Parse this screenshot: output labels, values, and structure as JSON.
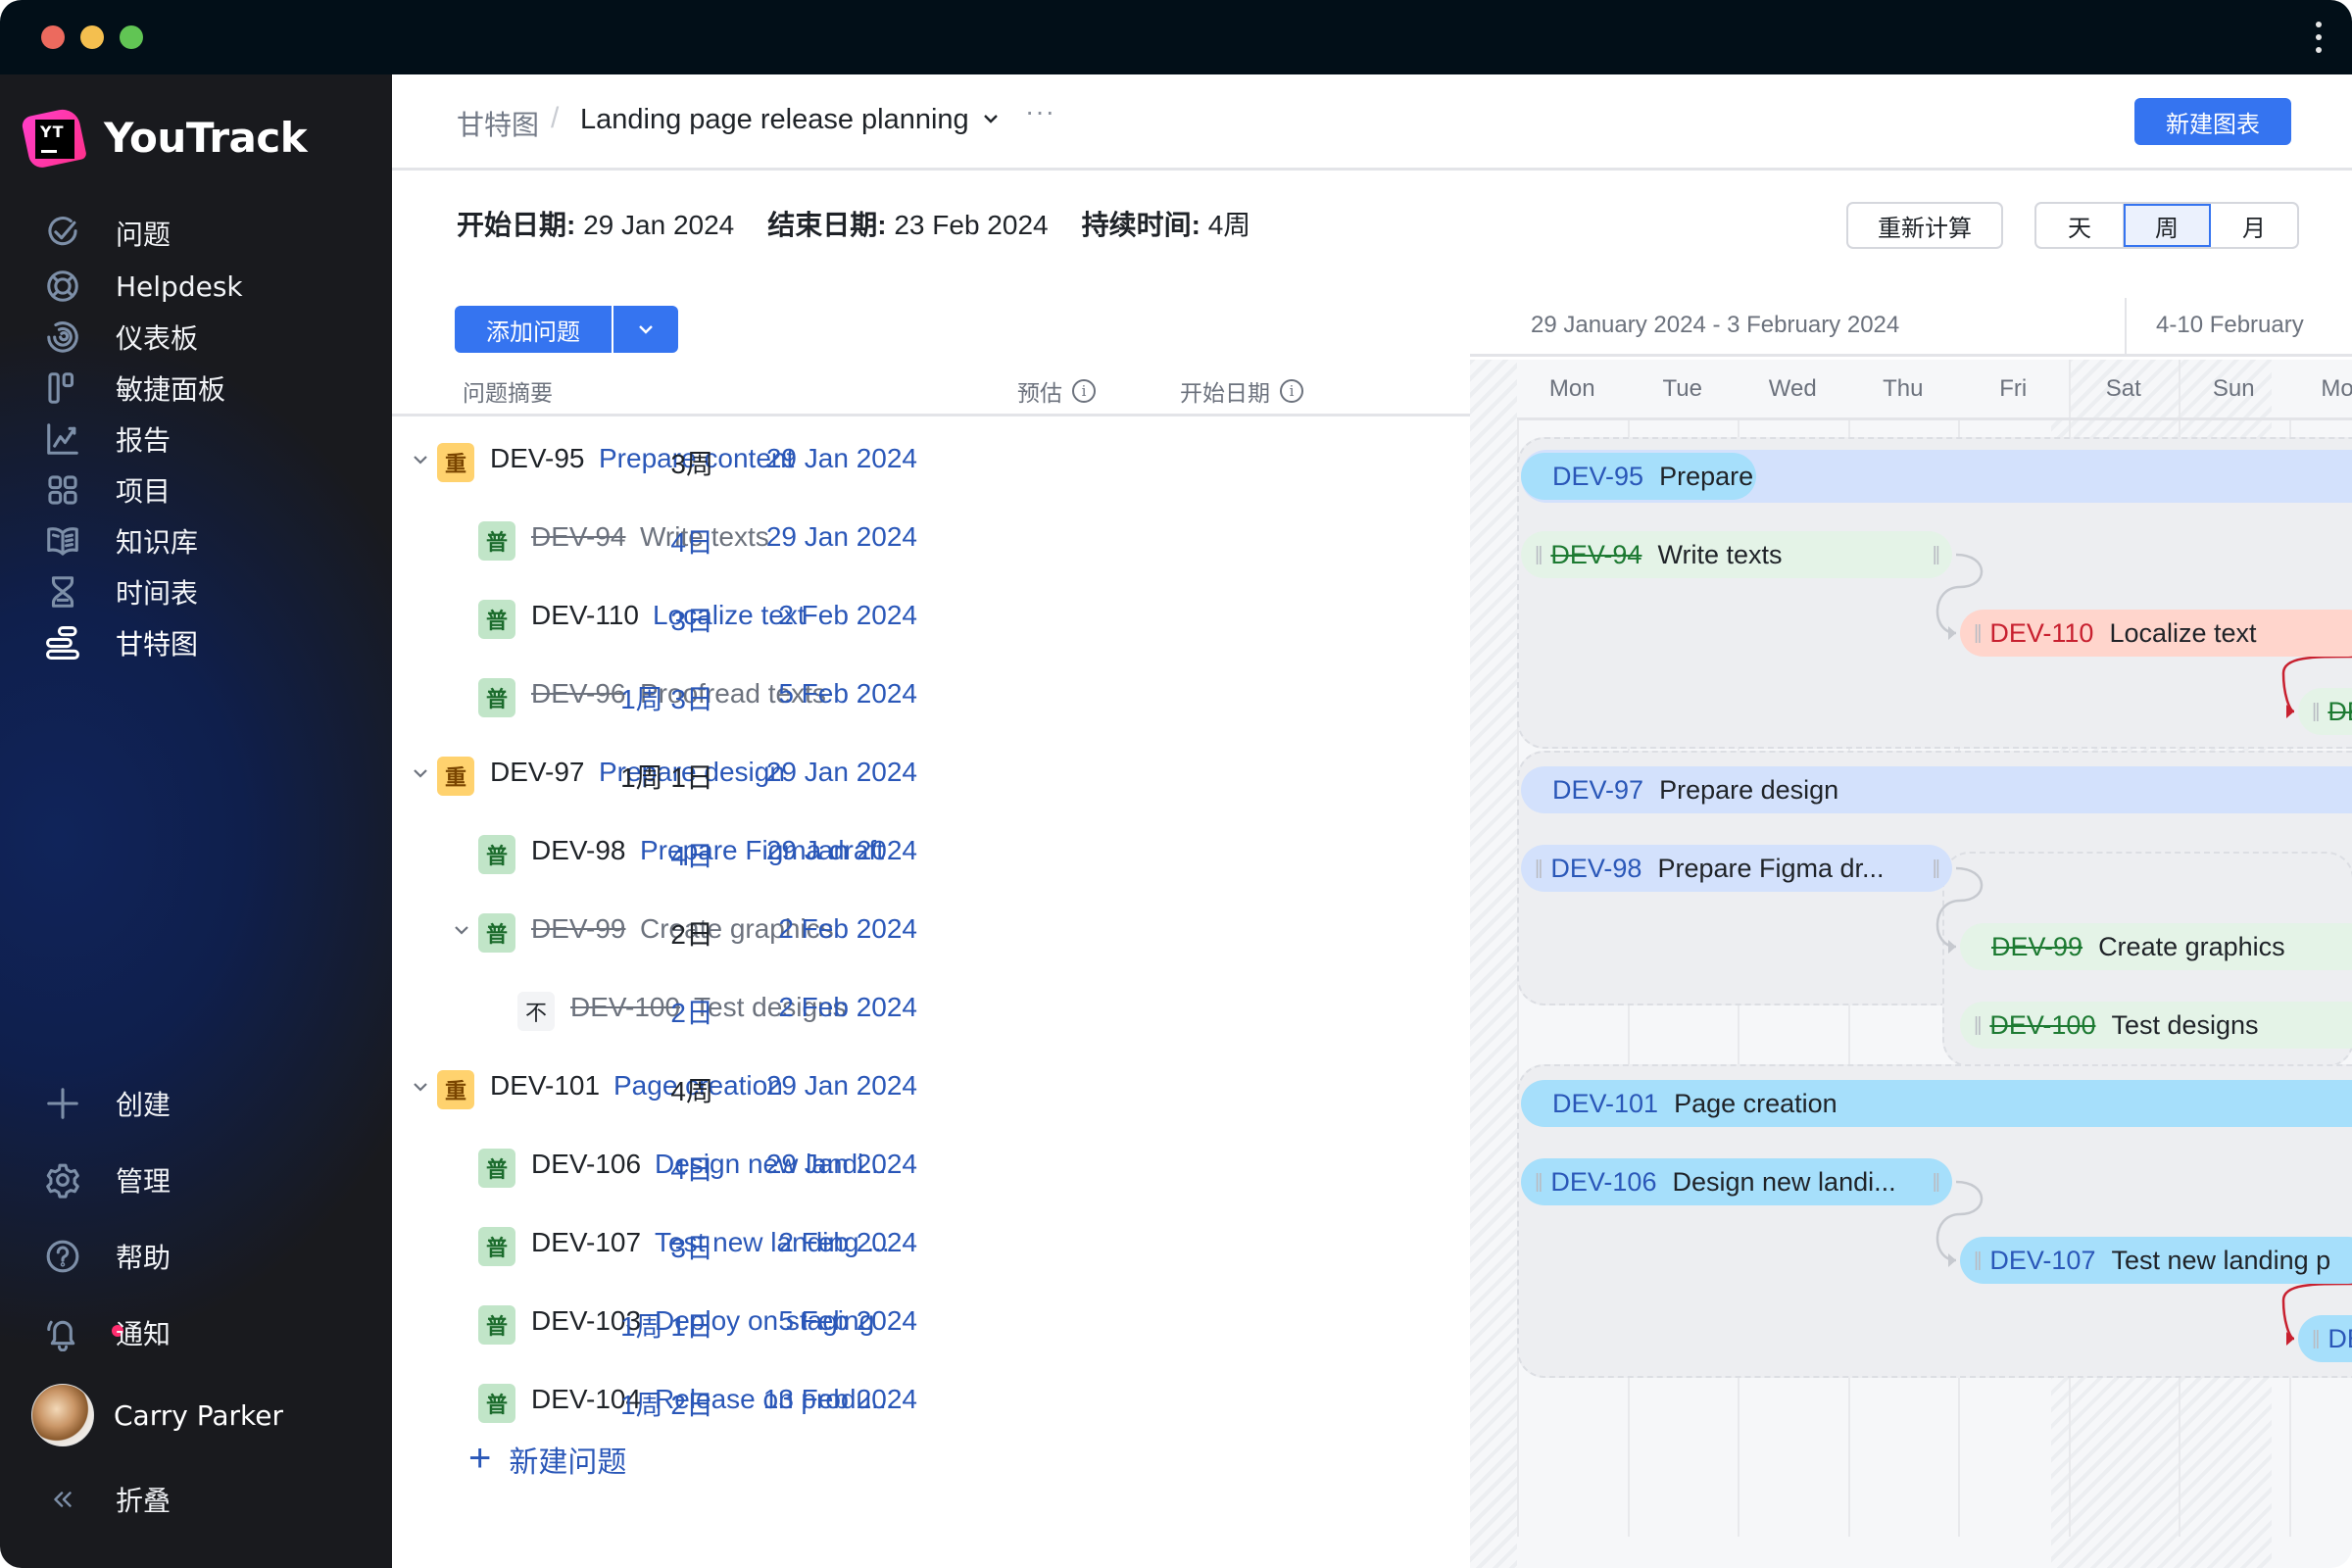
{
  "app": {
    "name": "YouTrack",
    "window_menu_icon": "kebab-icon"
  },
  "sidebar": {
    "items": [
      {
        "label": "问题",
        "icon": "check-circle-icon"
      },
      {
        "label": "Helpdesk",
        "icon": "lifebuoy-icon"
      },
      {
        "label": "仪表板",
        "icon": "dashboard-icon"
      },
      {
        "label": "敏捷面板",
        "icon": "agile-board-icon"
      },
      {
        "label": "报告",
        "icon": "chart-icon"
      },
      {
        "label": "项目",
        "icon": "grid-icon"
      },
      {
        "label": "知识库",
        "icon": "book-icon"
      },
      {
        "label": "时间表",
        "icon": "hourglass-icon"
      },
      {
        "label": "甘特图",
        "icon": "gantt-icon",
        "active": true
      }
    ],
    "bottom_items": [
      {
        "label": "创建",
        "icon": "plus-icon"
      },
      {
        "label": "管理",
        "icon": "gear-icon"
      },
      {
        "label": "帮助",
        "icon": "help-icon"
      },
      {
        "label": "通知",
        "icon": "bell-icon",
        "has_unread": true
      }
    ],
    "user": {
      "name": "Carry Parker"
    },
    "collapse_label": "折叠"
  },
  "header": {
    "breadcrumb_root": "甘特图",
    "breadcrumb_separator": "/",
    "chart_title": "Landing page release planning",
    "more": "···",
    "new_chart_button": "新建图表"
  },
  "stats": {
    "start_label": "开始日期:",
    "start_value": "29 Jan 2024",
    "end_label": "结束日期:",
    "end_value": "23 Feb 2024",
    "duration_label": "持续时间:",
    "duration_value": "4周"
  },
  "toolbar": {
    "recalculate": "重新计算",
    "scale_options": [
      "天",
      "周",
      "月"
    ],
    "scale_selected": "周",
    "add_issue": "添加问题"
  },
  "columns": {
    "summary": "问题摘要",
    "estimate": "预估",
    "start_date": "开始日期"
  },
  "issues": [
    {
      "id": "DEV-95",
      "summary": "Prepare content",
      "estimate": "3周",
      "start": "29 Jan 2024",
      "priority": "重",
      "priority_type": "major",
      "level": 0,
      "expanded": true,
      "resolved": false,
      "parent": true
    },
    {
      "id": "DEV-94",
      "summary": "Write texts",
      "estimate": "4日",
      "start": "29 Jan 2024",
      "priority": "普",
      "priority_type": "normal",
      "level": 1,
      "resolved": true
    },
    {
      "id": "DEV-110",
      "summary": "Localize text",
      "estimate": "3日",
      "start": "2 Feb 2024",
      "priority": "普",
      "priority_type": "normal",
      "level": 1,
      "resolved": false
    },
    {
      "id": "DEV-96",
      "summary": "Proofread texts",
      "estimate": "1周 3日",
      "start": "5 Feb 2024",
      "priority": "普",
      "priority_type": "normal",
      "level": 1,
      "resolved": true
    },
    {
      "id": "DEV-97",
      "summary": "Prepare design",
      "estimate": "1周 1日",
      "start": "29 Jan 2024",
      "priority": "重",
      "priority_type": "major",
      "level": 0,
      "expanded": true,
      "resolved": false,
      "parent": true
    },
    {
      "id": "DEV-98",
      "summary": "Prepare Figma draft",
      "estimate": "4日",
      "start": "29 Jan 2024",
      "priority": "普",
      "priority_type": "normal",
      "level": 1,
      "resolved": false
    },
    {
      "id": "DEV-99",
      "summary": "Create graphics",
      "estimate": "2日",
      "start": "2 Feb 2024",
      "priority": "普",
      "priority_type": "normal",
      "level": 1,
      "expanded": true,
      "resolved": true,
      "parent": true
    },
    {
      "id": "DEV-100",
      "summary": "Test designs",
      "estimate": "2日",
      "start": "2 Feb 2024",
      "priority": "不",
      "priority_type": "minor",
      "level": 2,
      "resolved": true
    },
    {
      "id": "DEV-101",
      "summary": "Page creation",
      "estimate": "4周",
      "start": "29 Jan 2024",
      "priority": "重",
      "priority_type": "major",
      "level": 0,
      "expanded": true,
      "resolved": false,
      "parent": true
    },
    {
      "id": "DEV-106",
      "summary": "Design new landi...",
      "estimate": "4日",
      "start": "29 Jan 2024",
      "priority": "普",
      "priority_type": "normal",
      "level": 1,
      "resolved": false
    },
    {
      "id": "DEV-107",
      "summary": "Test new landing ...",
      "estimate": "3日",
      "start": "2 Feb 2024",
      "priority": "普",
      "priority_type": "normal",
      "level": 1,
      "resolved": false
    },
    {
      "id": "DEV-103",
      "summary": "Deploy on staging",
      "estimate": "1周 1日",
      "start": "5 Feb 2024",
      "priority": "普",
      "priority_type": "normal",
      "level": 1,
      "resolved": false
    },
    {
      "id": "DEV-104",
      "summary": "Release on produ...",
      "estimate": "1周 2日",
      "start": "13 Feb 2024",
      "priority": "普",
      "priority_type": "normal",
      "level": 1,
      "resolved": false
    }
  ],
  "new_issue_label": "新建问题",
  "gantt": {
    "weeks": [
      "29 January 2024 - 3 February 2024",
      "4-10 February"
    ],
    "days": [
      "Mon",
      "Tue",
      "Wed",
      "Thu",
      "Fri",
      "Sat",
      "Sun",
      "Mon"
    ],
    "weekend_days": [
      "Sat",
      "Sun"
    ],
    "bars": [
      {
        "id": "DEV-95",
        "title": "Prepare content",
        "style": "parent-cyan"
      },
      {
        "id": "DEV-94",
        "title": "Write texts",
        "style": "done"
      },
      {
        "id": "DEV-110",
        "title": "Localize text",
        "style": "overdue"
      },
      {
        "id": "DEV-96",
        "title": "",
        "style": "done",
        "id_visible": "DE"
      },
      {
        "id": "DEV-97",
        "title": "Prepare design",
        "style": "parent-lav"
      },
      {
        "id": "DEV-98",
        "title": "Prepare Figma dr...",
        "style": "blue"
      },
      {
        "id": "DEV-99",
        "title": "Create graphics",
        "style": "done"
      },
      {
        "id": "DEV-100",
        "title": "Test designs",
        "style": "done"
      },
      {
        "id": "DEV-101",
        "title": "Page creation",
        "style": "cyan"
      },
      {
        "id": "DEV-106",
        "title": "Design new landi...",
        "style": "cyan"
      },
      {
        "id": "DEV-107",
        "title": "Test new landing p",
        "style": "cyan"
      },
      {
        "id": "DEV-103",
        "title": "",
        "style": "cyan",
        "id_visible": "DE"
      }
    ],
    "colors": {
      "accent": "#3574f0",
      "link_blue": "#2a57b8",
      "overdue_red": "#c8202f",
      "done_green": "#1d7a32",
      "priority_major": "#ffd26e",
      "priority_normal": "#c1e5c8"
    }
  }
}
